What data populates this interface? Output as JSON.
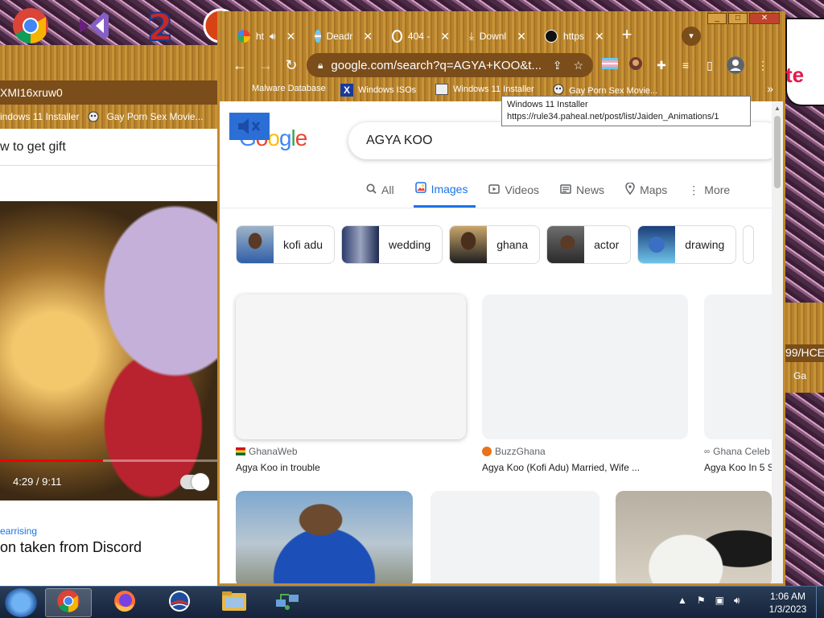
{
  "desktop": {
    "icons": [
      "chrome-icon",
      "visual-studio-icon",
      "number-two-icon",
      "red-ball-icon"
    ]
  },
  "left_window": {
    "url_fragment": "XMI16xruw0",
    "bookmarks": [
      "indows 11 Installer",
      "Gay Porn Sex Movie..."
    ],
    "search_text": "w to get gift",
    "video_time": "4:29 / 9:11",
    "video_progress": 0.47,
    "channel": "earrising",
    "video_title": "on taken from Discord"
  },
  "right_strip": {
    "partial_text": "te",
    "url_fragment": "99/HCE",
    "bookmark_fragment": "Ga"
  },
  "main": {
    "tabs": [
      {
        "label": "ht",
        "icon": "google-icon",
        "muted": true
      },
      {
        "label": "Deadr",
        "icon": "trans-flag-icon"
      },
      {
        "label": "404 -",
        "icon": "globe-icon"
      },
      {
        "label": "Downl",
        "icon": "download-icon"
      },
      {
        "label": "https",
        "icon": "ea-icon"
      }
    ],
    "new_tab_label": "+",
    "url": "google.com/search?q=AGYA+KOO&t...",
    "bookmarks": [
      {
        "label": "Malware Database",
        "icon": "none"
      },
      {
        "label": "Windows ISOs",
        "icon": "x-icon"
      },
      {
        "label": "Windows 11 Installer",
        "icon": "image-icon"
      },
      {
        "label": "Gay Porn Sex Movie...",
        "icon": "mascot-icon"
      }
    ],
    "bookmarks_overflow": "»",
    "tooltip": {
      "title": "Windows 11 Installer",
      "url": "https://rule34.paheal.net/post/list/Jaiden_Animations/1"
    }
  },
  "google": {
    "query": "AGYA KOO",
    "tabs": [
      {
        "label": "All",
        "icon": "search-icon"
      },
      {
        "label": "Images",
        "icon": "image-icon",
        "active": true
      },
      {
        "label": "Videos",
        "icon": "video-icon"
      },
      {
        "label": "News",
        "icon": "news-icon"
      },
      {
        "label": "Maps",
        "icon": "map-pin-icon"
      },
      {
        "label": "More",
        "icon": "more-dots-icon"
      }
    ],
    "chips": [
      "kofi adu",
      "wedding",
      "ghana",
      "actor",
      "drawing"
    ],
    "results": [
      {
        "source": "GhanaWeb",
        "title": "Agya Koo in trouble"
      },
      {
        "source": "BuzzGhana",
        "title": "Agya Koo (Kofi Adu) Married, Wife ..."
      },
      {
        "source": "Ghana Celeb",
        "title": "Agya Koo In 5 S"
      }
    ]
  },
  "taskbar": {
    "apps": [
      "chrome-icon",
      "firefox-icon",
      "obama-logo-icon",
      "file-explorer-icon",
      "network-icon"
    ],
    "time": "1:06 AM",
    "date": "1/3/2023"
  },
  "colors": {
    "google_blue": "#1a73e8",
    "chrome_theme": "#b5822e"
  }
}
